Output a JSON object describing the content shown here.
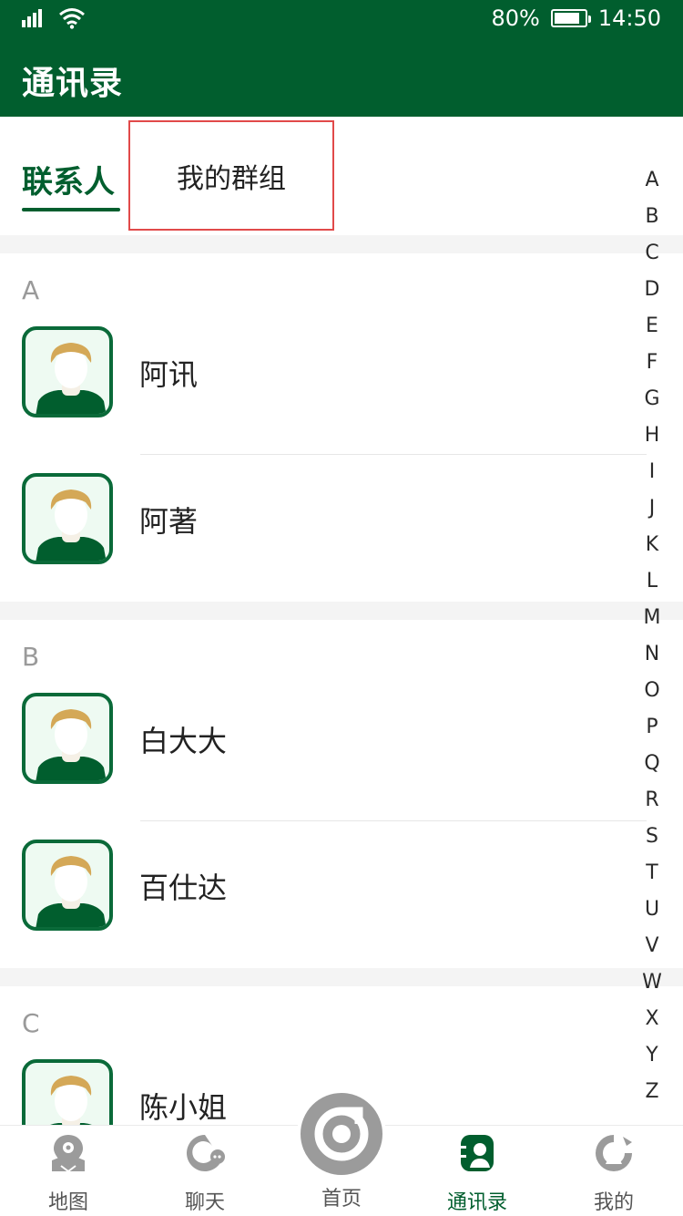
{
  "status_bar": {
    "battery_text": "80%",
    "time": "14:50"
  },
  "header": {
    "title": "通讯录"
  },
  "tabs": {
    "contacts": "联系人",
    "groups": "我的群组"
  },
  "sections": [
    {
      "letter": "A",
      "contacts": [
        "阿讯",
        "阿著"
      ]
    },
    {
      "letter": "B",
      "contacts": [
        "白大大",
        "百仕达"
      ]
    },
    {
      "letter": "C",
      "contacts": [
        "陈小姐"
      ]
    }
  ],
  "alphabet": [
    "A",
    "B",
    "C",
    "D",
    "E",
    "F",
    "G",
    "H",
    "I",
    "J",
    "K",
    "L",
    "M",
    "N",
    "O",
    "P",
    "Q",
    "R",
    "S",
    "T",
    "U",
    "V",
    "W",
    "X",
    "Y",
    "Z"
  ],
  "bottom_nav": {
    "map": "地图",
    "chat": "聊天",
    "home": "首页",
    "contacts": "通讯录",
    "mine": "我的"
  },
  "colors": {
    "brand": "#015e2e",
    "highlight_box": "#e14a4a",
    "avatar_border": "#0a6a39"
  }
}
